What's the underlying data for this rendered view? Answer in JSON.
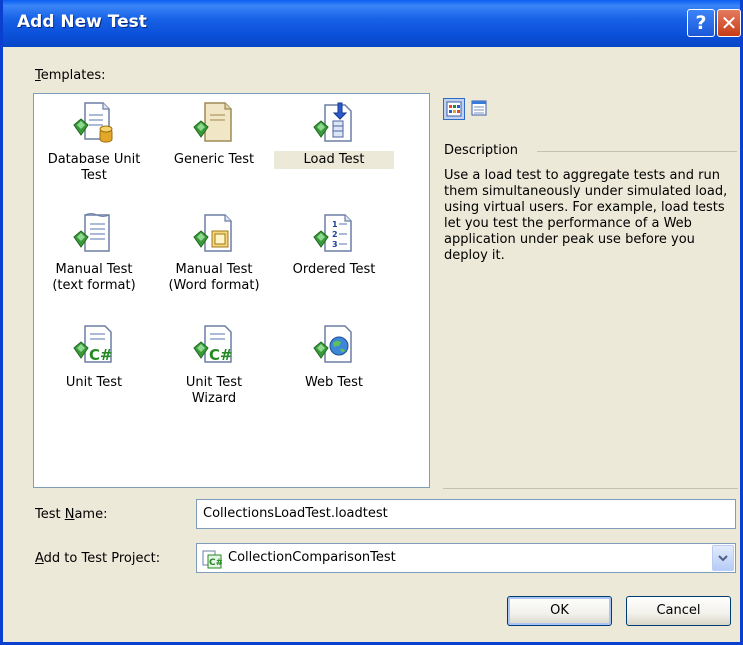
{
  "window": {
    "title": "Add New Test",
    "help_glyph": "?",
    "close_glyph": "✕"
  },
  "templates": {
    "label_mnemonic": "T",
    "label_rest": "emplates:",
    "items": [
      {
        "label_line1": "Database Unit",
        "label_line2": "Test",
        "icon": "database-unit-test-icon"
      },
      {
        "label_line1": "Generic Test",
        "label_line2": "",
        "icon": "generic-test-icon"
      },
      {
        "label_line1": "Load Test",
        "label_line2": "",
        "icon": "load-test-icon"
      },
      {
        "label_line1": "Manual Test",
        "label_line2": "(text format)",
        "icon": "manual-test-text-icon"
      },
      {
        "label_line1": "Manual Test",
        "label_line2": "(Word format)",
        "icon": "manual-test-word-icon"
      },
      {
        "label_line1": "Ordered Test",
        "label_line2": "",
        "icon": "ordered-test-icon"
      },
      {
        "label_line1": "Unit Test",
        "label_line2": "",
        "icon": "unit-test-icon"
      },
      {
        "label_line1": "Unit Test",
        "label_line2": "Wizard",
        "icon": "unit-test-wizard-icon"
      },
      {
        "label_line1": "Web Test",
        "label_line2": "",
        "icon": "web-test-icon"
      }
    ],
    "selected": "Load Test"
  },
  "description": {
    "heading": "Description",
    "text": "Use a load test to aggregate tests and run them simultaneously under simulated load, using virtual users. For example, load tests let you test the performance of a Web application under peak use before you deploy it."
  },
  "form": {
    "test_name_label_pre": "Test ",
    "test_name_label_mnemonic": "N",
    "test_name_label_post": "ame:",
    "test_name_value": "CollectionsLoadTest.loadtest",
    "project_label_mnemonic": "A",
    "project_label_rest": "dd to Test Project:",
    "project_value": "CollectionComparisonTest"
  },
  "buttons": {
    "ok": "OK",
    "cancel": "Cancel"
  },
  "colors": {
    "titlebar": "#0a4fd8",
    "dialog_bg": "#ece9d8",
    "icon_green": "#3a9a3a",
    "selection_bg": "#ece9d8"
  }
}
